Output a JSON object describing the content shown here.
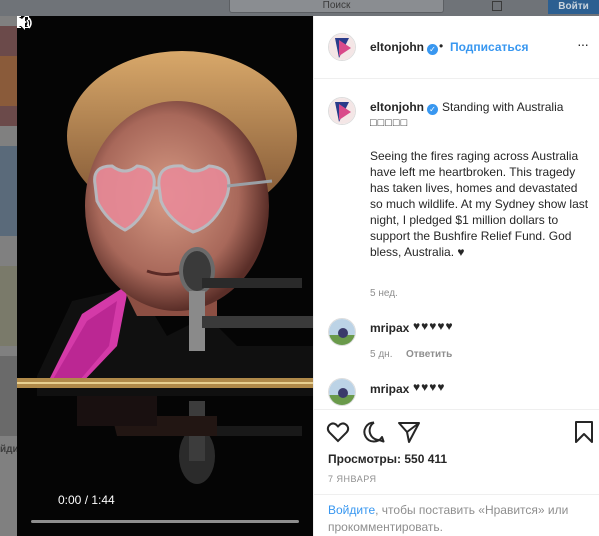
{
  "background": {
    "search_placeholder": "Поиск",
    "login_label": "Войти",
    "left_partial_text": "йди"
  },
  "video": {
    "time": "0:00 / 1:44",
    "progress": 0.0,
    "play_icon": "play-icon",
    "volume_icon": "volume-icon",
    "fullscreen_icon": "fullscreen-icon"
  },
  "header": {
    "username": "eltonjohn",
    "separator": "•",
    "follow_label": "Подписаться",
    "more_label": "···"
  },
  "caption": {
    "username": "eltonjohn",
    "title": "Standing with Australia",
    "emoji": "□□□□□",
    "body": "Seeing the fires raging across Australia have left me heartbroken. This tragedy has taken lives, homes and devastated so much wildlife. At my Sydney show last night, I pledged $1 million dollars to support the Bushfire Relief Fund. God bless, Australia. ♥",
    "time": "5 нед."
  },
  "comments": [
    {
      "username": "mripax",
      "text": "♥♥♥♥♥",
      "time": "5 дн.",
      "reply_label": "Ответить"
    },
    {
      "username": "mripax",
      "text": "♥♥♥♥"
    }
  ],
  "stats": {
    "views_label": "Просмотры:",
    "views_value": "550 411",
    "date": "7 ЯНВАРЯ"
  },
  "login_prompt": {
    "link": "Войдите",
    "rest": ", чтобы поставить «Нравится» или прокомментировать."
  },
  "colors": {
    "accent": "#3897f0",
    "muted": "#8e8e8e",
    "text": "#262626"
  }
}
